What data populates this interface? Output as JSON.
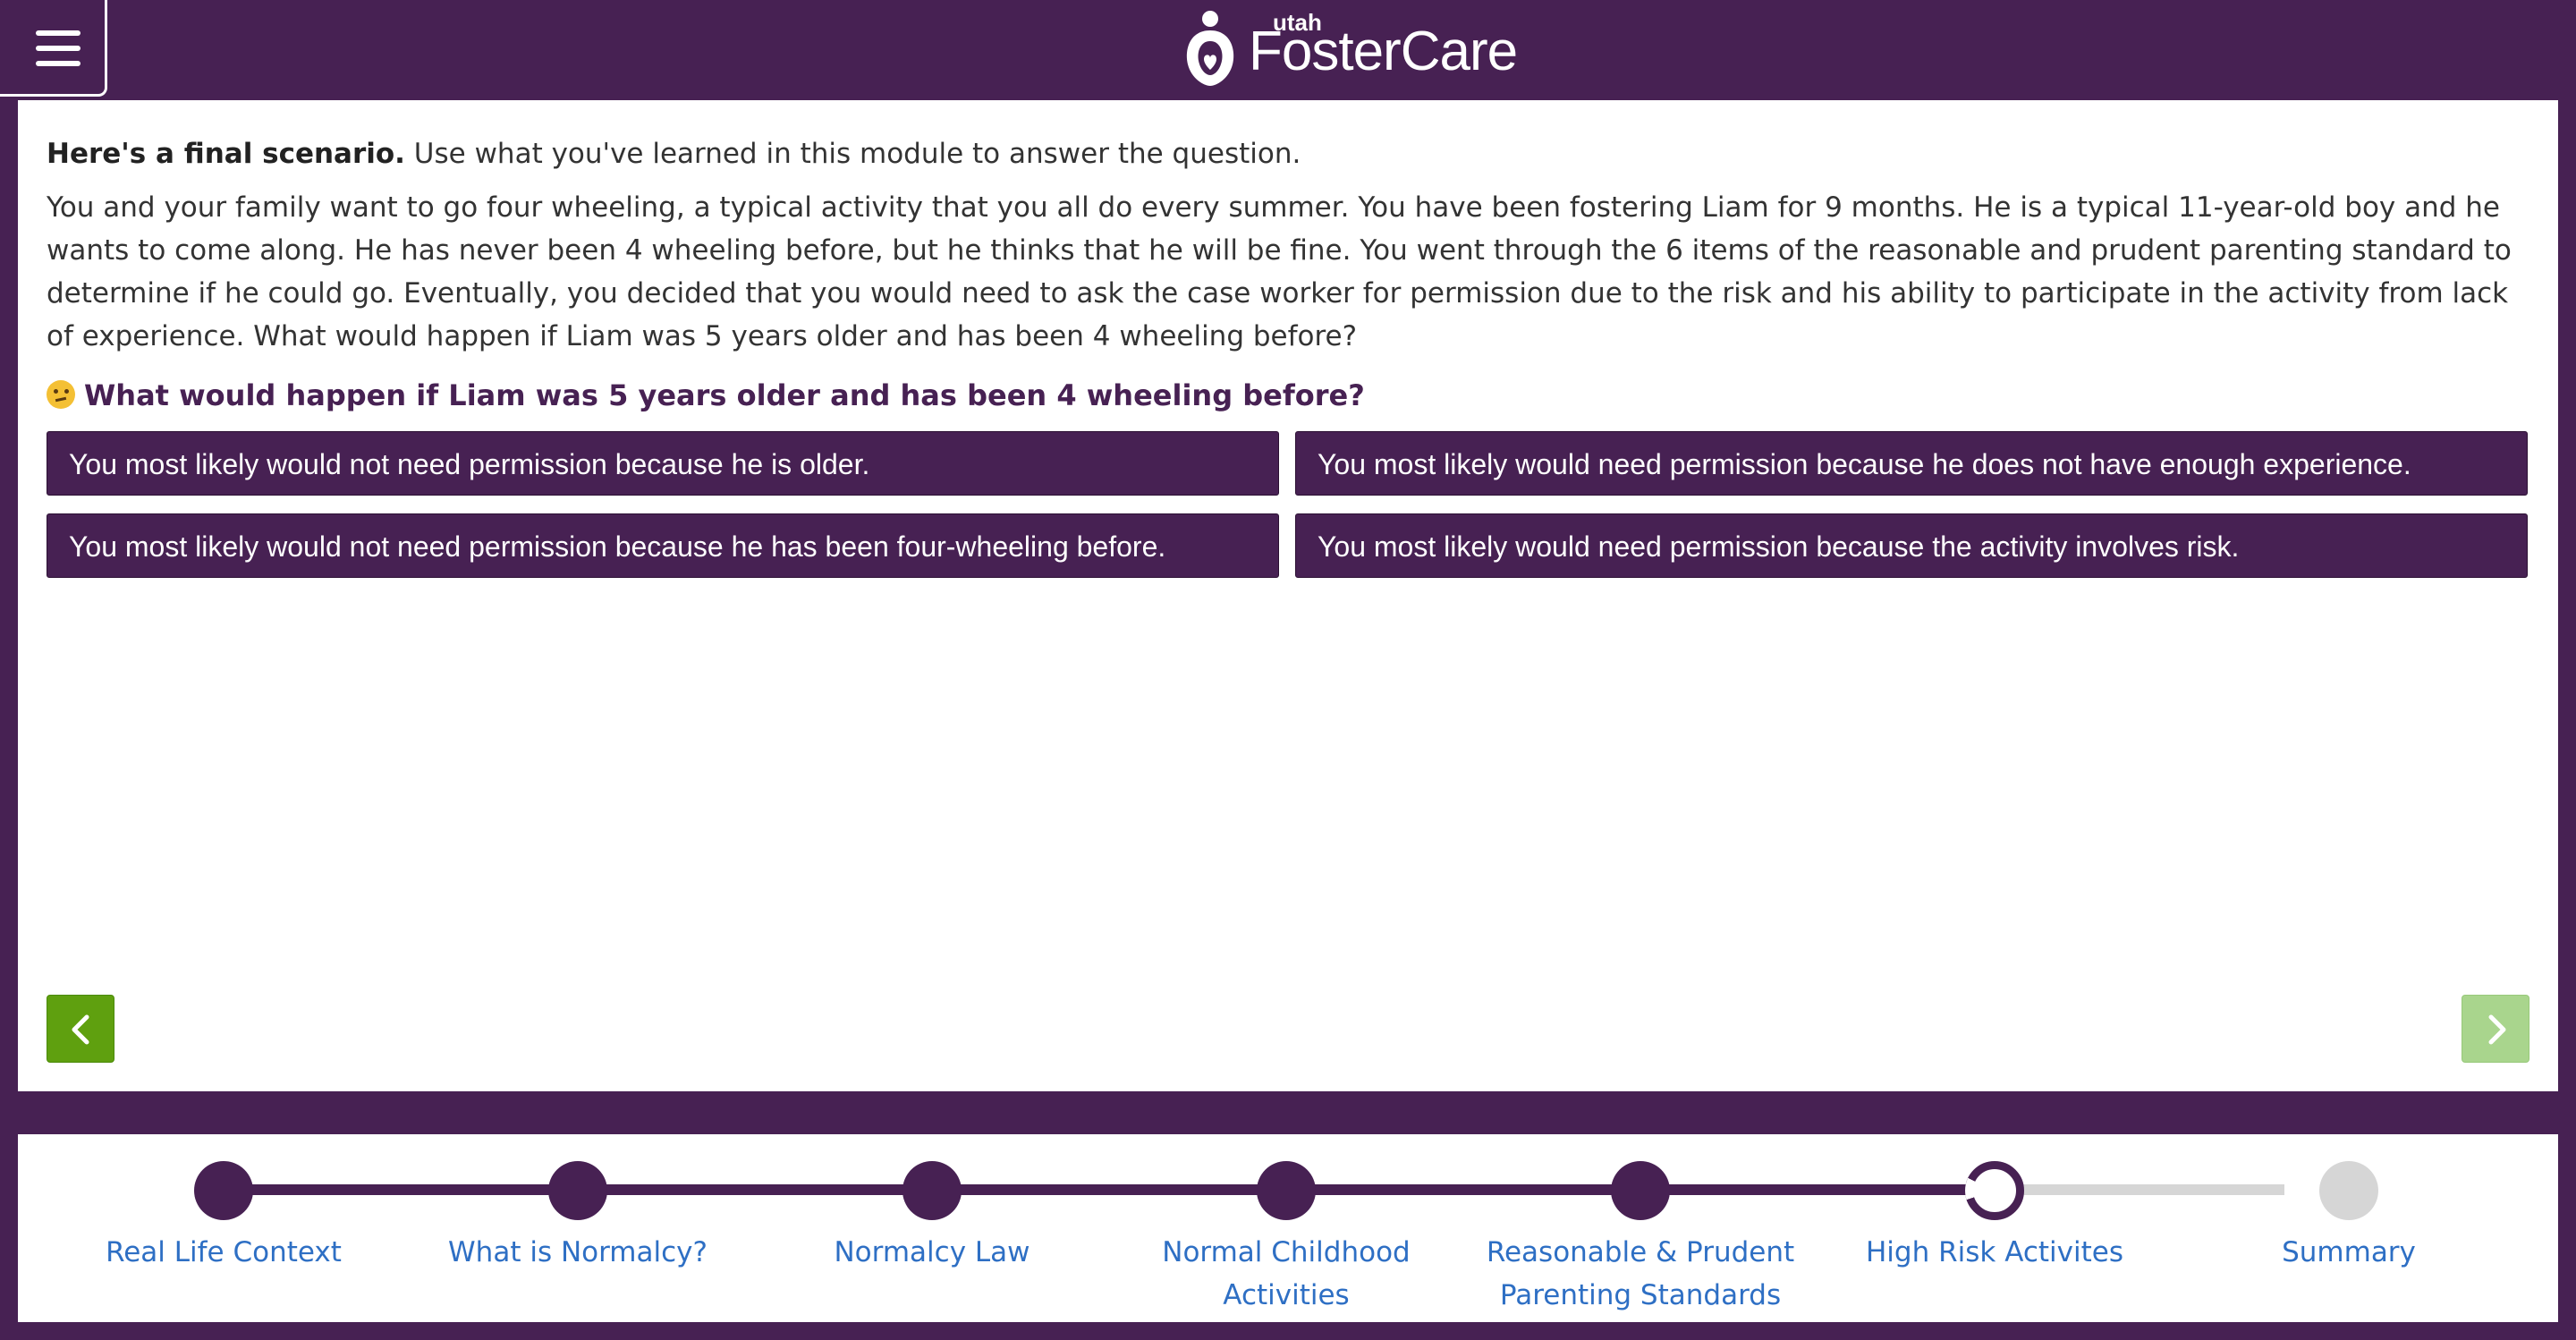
{
  "header": {
    "logo_small": "utah",
    "logo_main": "FosterCare"
  },
  "content": {
    "intro_bold": "Here's a final scenario.",
    "intro_text": " Use what you've learned in this module to answer the question.",
    "scenario": "You and your family want to go four wheeling, a typical activity that you all do every summer. You have been fostering Liam for 9 months. He is a typical 11-year-old boy and he wants to come along. He has never been 4 wheeling before, but he thinks that he will be fine. You went through the 6 items of the reasonable and prudent parenting standard to determine if he could go. Eventually, you decided that you would need to ask the case worker for permission due to the risk and his ability to participate in the activity from lack of experience. What would happen if Liam was 5 years older and has been 4 wheeling before?",
    "question": "What would happen if Liam was 5 years older and has been 4 wheeling before?",
    "question_icon": "thinking-face-icon",
    "answers": [
      "You most likely would not need permission because he is older.",
      "You most likely would need permission because he does not have enough experience.",
      "You most likely would not need permission because he has been four-wheeling before.",
      "You most likely would need permission because the activity involves risk."
    ]
  },
  "navigation": {
    "prev_icon": "chevron-left-icon",
    "next_icon": "chevron-right-icon"
  },
  "progress": {
    "steps": [
      {
        "label": "Real Life Context",
        "state": "done"
      },
      {
        "label": "What is Normalcy?",
        "state": "done"
      },
      {
        "label": "Normalcy Law",
        "state": "done"
      },
      {
        "label": "Normal Childhood Activities",
        "state": "done"
      },
      {
        "label": "Reasonable & Prudent Parenting Standards",
        "state": "done"
      },
      {
        "label": "High Risk Activites",
        "state": "current"
      },
      {
        "label": "Summary",
        "state": "future"
      }
    ]
  },
  "colors": {
    "brand_purple": "#472153",
    "back_button": "#5fa00f",
    "next_button_disabled": "#a9d58d",
    "link": "#2e6fc4"
  }
}
